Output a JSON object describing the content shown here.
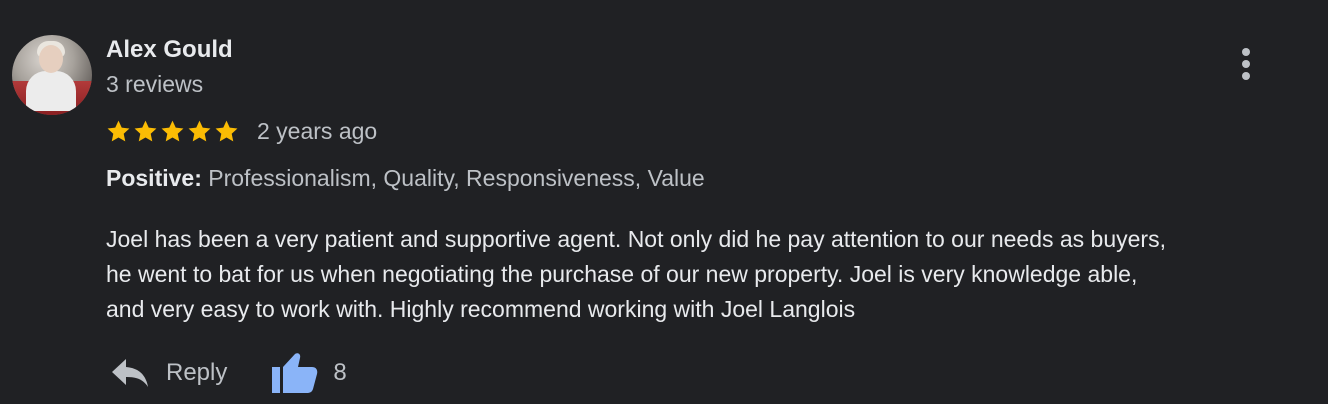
{
  "review": {
    "author_name": "Alex Gould",
    "review_count": "3 reviews",
    "rating": 5,
    "max_rating": 5,
    "time_ago": "2 years ago",
    "positive_label": "Positive:",
    "positive_values": "Professionalism, Quality, Responsiveness, Value",
    "text_lines": [
      "Joel has been a very patient and supportive agent. Not only did he pay attention to our needs as buyers,",
      "he went to bat for us when negotiating the purchase of our new property. Joel is very knowledge able,",
      "and very easy to work with. Highly recommend working with Joel Langlois"
    ]
  },
  "actions": {
    "reply_label": "Reply",
    "like_count": "8"
  },
  "icons": {
    "menu": "more-vert-icon",
    "reply": "reply-icon",
    "like": "thumbs-up-icon",
    "star": "star-icon"
  },
  "colors": {
    "background": "#202124",
    "star": "#fbbc04",
    "like_icon": "#8ab4f8",
    "secondary_text": "#bdc1c6",
    "primary_text": "#e8eaed"
  }
}
